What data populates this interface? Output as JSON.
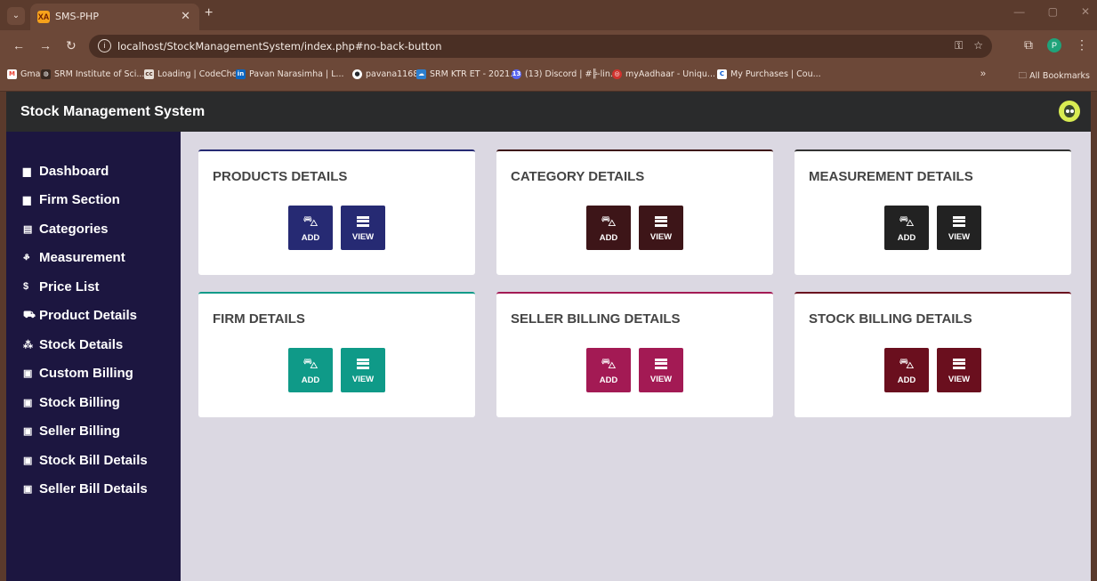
{
  "browser": {
    "tab_title": "SMS-PHP",
    "tab_favicon": "XA",
    "url": "localhost/StockManagementSystem/index.php#no-back-button",
    "profile_initial": "P",
    "bookmarks": [
      {
        "label": "Gmail",
        "icon": "gmail-icon",
        "color": "#ea4335",
        "glyph": "M"
      },
      {
        "label": "SRM Institute of Sci...",
        "icon": "globe-icon",
        "color": "#5a3a2c",
        "glyph": "◍"
      },
      {
        "label": "Loading | CodeChef",
        "icon": "codechef-icon",
        "color": "#6b4e3d",
        "glyph": "cc"
      },
      {
        "label": "Pavan Narasimha | L...",
        "icon": "linkedin-icon",
        "color": "#0a66c2",
        "glyph": "in"
      },
      {
        "label": "pavana1168",
        "icon": "github-icon",
        "color": "#24292f",
        "glyph": "●"
      },
      {
        "label": "SRM KTR ET - 2021...",
        "icon": "cloud-icon",
        "color": "#2b7fd0",
        "glyph": "☁"
      },
      {
        "label": "(13) Discord | #╠-lin...",
        "icon": "discord-icon",
        "color": "#5865f2",
        "glyph": "13"
      },
      {
        "label": "myAadhaar - Uniqu...",
        "icon": "aadhaar-icon",
        "color": "#d0322d",
        "glyph": "◎"
      },
      {
        "label": "My Purchases | Cou...",
        "icon": "coursera-icon",
        "color": "#0056d2",
        "glyph": "C"
      }
    ],
    "all_bookmarks": "All Bookmarks"
  },
  "app": {
    "title": "Stock Management System"
  },
  "sidebar": {
    "items": [
      {
        "label": "Dashboard",
        "icon": "table-icon",
        "glyph": "▆"
      },
      {
        "label": "Firm Section",
        "icon": "table-icon",
        "glyph": "▆"
      },
      {
        "label": "Categories",
        "icon": "list-icon",
        "glyph": "▤"
      },
      {
        "label": "Measurement",
        "icon": "balance-scale-icon",
        "glyph": "ቆ"
      },
      {
        "label": "Price List",
        "icon": "dollar-icon",
        "glyph": "$"
      },
      {
        "label": "Product Details",
        "icon": "cart-icon",
        "glyph": "⛟"
      },
      {
        "label": "Stock Details",
        "icon": "cubes-icon",
        "glyph": "⁂"
      },
      {
        "label": "Custom Billing",
        "icon": "clipboard-icon",
        "glyph": "▣"
      },
      {
        "label": "Stock Billing",
        "icon": "clipboard-icon",
        "glyph": "▣"
      },
      {
        "label": "Seller Billing",
        "icon": "clipboard-plus-icon",
        "glyph": "▣"
      },
      {
        "label": "Stock Bill Details",
        "icon": "clipboard-icon",
        "glyph": "▣"
      },
      {
        "label": "Seller Bill Details",
        "icon": "clipboard-icon",
        "glyph": "▣"
      }
    ]
  },
  "cards": [
    {
      "title": "PRODUCTS DETAILS",
      "color": "#262a73",
      "border": "#262a73",
      "add": "ADD",
      "view": "VIEW"
    },
    {
      "title": "CATEGORY DETAILS",
      "color": "#3d1518",
      "border": "#3d1518",
      "add": "ADD",
      "view": "VIEW"
    },
    {
      "title": "MEASUREMENT DETAILS",
      "color": "#222222",
      "border": "#333333",
      "add": "ADD",
      "view": "VIEW"
    },
    {
      "title": "FIRM DETAILS",
      "color": "#0f9a88",
      "border": "#0f9a88",
      "add": "ADD",
      "view": "VIEW"
    },
    {
      "title": "SELLER BILLING DETAILS",
      "color": "#a31a54",
      "border": "#a31a54",
      "add": "ADD",
      "view": "VIEW"
    },
    {
      "title": "STOCK BILLING DETAILS",
      "color": "#6a0f1e",
      "border": "#6a0f1e",
      "add": "ADD",
      "view": "VIEW"
    }
  ]
}
